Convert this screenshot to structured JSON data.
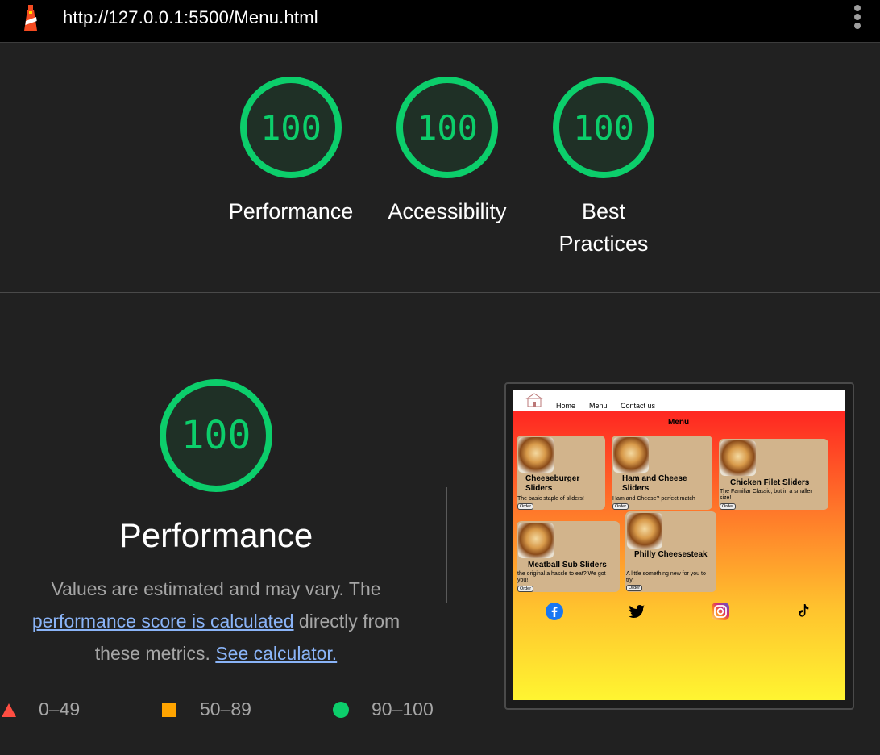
{
  "url": "http://127.0.0.1:5500/Menu.html",
  "summary": [
    {
      "score": "100",
      "label": "Performance"
    },
    {
      "score": "100",
      "label": "Accessibility"
    },
    {
      "score": "100",
      "label": "Best Practices"
    }
  ],
  "performance": {
    "score": "100",
    "title": "Performance",
    "desc_prefix": "Values are estimated and may vary. The ",
    "desc_link": "performance score is calculated",
    "desc_middle": " directly from these metrics. ",
    "calc_link": "See calculator."
  },
  "legend": [
    {
      "range": "0–49",
      "color": "#ff4e42"
    },
    {
      "range": "50–89",
      "color": "#ffa400"
    },
    {
      "range": "90–100",
      "color": "#0cce6b"
    }
  ],
  "colors": {
    "pass": "#0cce6b",
    "average": "#ffa400",
    "fail": "#ff4e42",
    "background": "#212121"
  },
  "screenshot": {
    "nav": [
      "Home",
      "Menu",
      "Contact us"
    ],
    "title": "Menu",
    "items": [
      {
        "name": "Cheeseburger Sliders",
        "desc": "The basic staple of sliders!",
        "order": "Order"
      },
      {
        "name": "Ham and Cheese Sliders",
        "desc": "Ham and Cheese? perfect match",
        "order": "Order"
      },
      {
        "name": "Chicken Filet Sliders",
        "desc": "The Familiar Classic, but in a smaller size!",
        "order": "Order"
      },
      {
        "name": "Meatball Sub Sliders",
        "desc": "the original a hassle to eat? We got you!",
        "order": "Order"
      },
      {
        "name": "Philly Cheesesteak",
        "desc": "A little something new for you to try!",
        "order": "Order"
      }
    ],
    "social": [
      "facebook-icon",
      "twitter-icon",
      "instagram-icon",
      "tiktok-icon"
    ]
  }
}
